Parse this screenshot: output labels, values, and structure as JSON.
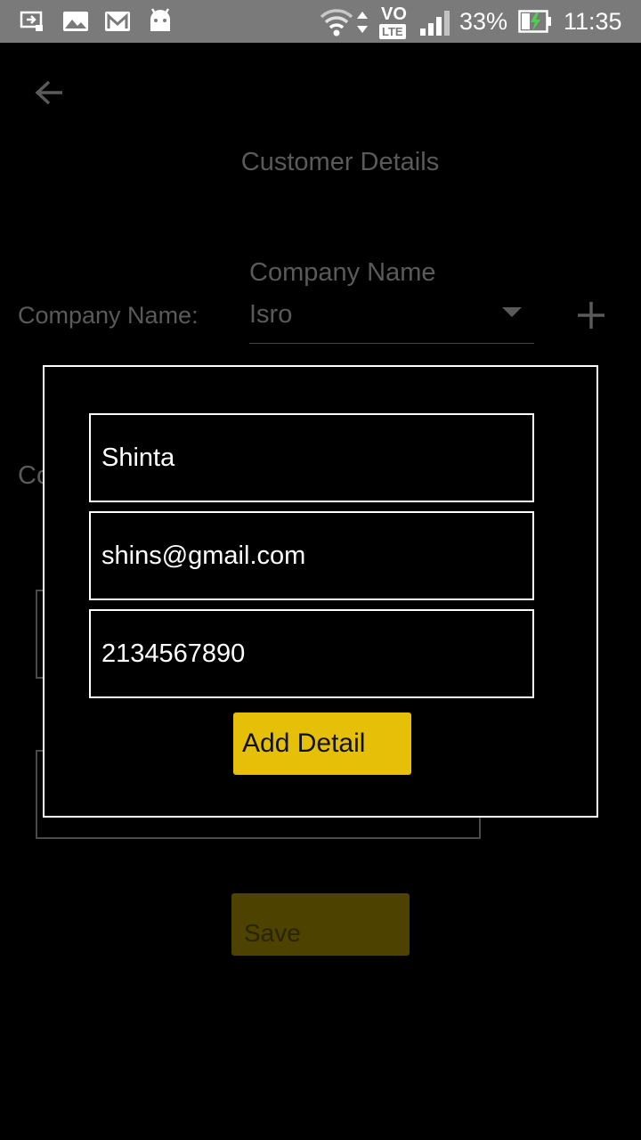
{
  "status_bar": {
    "battery": "33%",
    "time": "11:35",
    "volte": "VO",
    "lte": "LTE",
    "icons": [
      "screen-cast-icon",
      "gallery-icon",
      "gmail-icon",
      "android-icon",
      "wifi-icon",
      "data-arrows-icon",
      "volte-icon",
      "signal-icon",
      "battery-charging-icon"
    ]
  },
  "page": {
    "title": "Customer Details",
    "back_icon": "arrow-left-icon",
    "company_label": "Company Name:",
    "company_float_label": "Company Name",
    "company_value": "Isro",
    "add_company_icon": "plus-icon",
    "partial_label": "Co",
    "save_label": "Save"
  },
  "dialog": {
    "name_value": "Shinta",
    "email_value": "shins@gmail.com",
    "phone_value": "2134567890",
    "add_button_label": "Add Detail"
  },
  "colors": {
    "status_bar_bg": "#7a7a7a",
    "accent_button": "#e6c008",
    "dim_button": "#4d4200",
    "background": "#000000"
  }
}
